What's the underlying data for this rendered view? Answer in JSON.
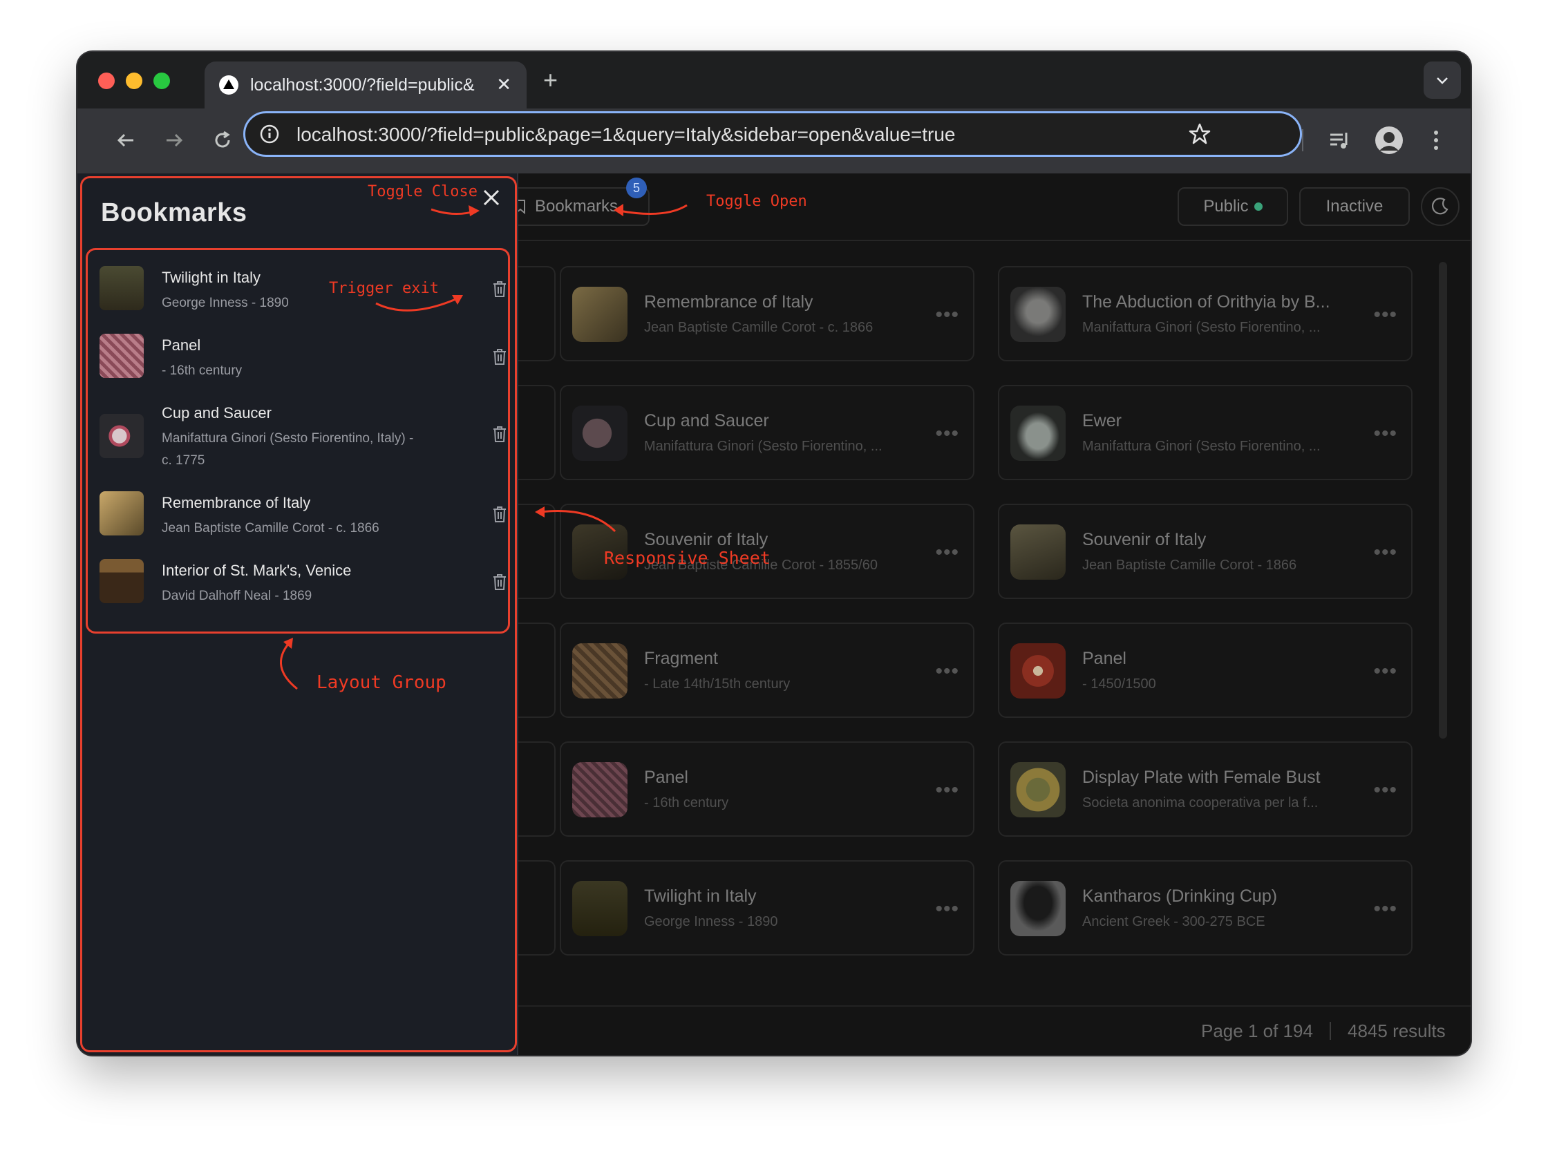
{
  "browser": {
    "tab_title": "localhost:3000/?field=public&",
    "url": "localhost:3000/?field=public&page=1&query=Italy&sidebar=open&value=true",
    "new_tab_label": "+",
    "tab_close_label": "✕"
  },
  "sidebar": {
    "title": "Bookmarks",
    "items": [
      {
        "title": "Twilight in Italy",
        "subtitle": "George Inness - 1890",
        "thumb": "#3f3a25"
      },
      {
        "title": "Panel",
        "subtitle": "- 16th century",
        "thumb": "#9c5a6a"
      },
      {
        "title": "Cup and Saucer",
        "subtitle": "Manifattura Ginori (Sesto Fiorentino, Italy) - c. 1775",
        "thumb": "#2c2c30"
      },
      {
        "title": "Remembrance of Italy",
        "subtitle": "Jean Baptiste Camille Corot - c. 1866",
        "thumb": "#6d5a36"
      },
      {
        "title": "Interior of St. Mark's, Venice",
        "subtitle": "David Dalhoff Neal - 1869",
        "thumb": "#4a3522"
      }
    ]
  },
  "topbar": {
    "bookmarks_label": "Bookmarks",
    "bookmarks_count": "5",
    "public_label": "Public",
    "inactive_label": "Inactive"
  },
  "grid": {
    "col1": [
      {
        "title": "Remembrance of Italy",
        "subtitle": "Jean Baptiste Camille Corot - c. 1866",
        "thumb": "#5e5033"
      },
      {
        "title": "Cup and Saucer",
        "subtitle": "Manifattura Ginori (Sesto Fiorentino, ...",
        "thumb": "#2a2a2e"
      },
      {
        "title": "Souvenir of Italy",
        "subtitle": "Jean Baptiste Camille Corot - 1855/60",
        "thumb": "#2d2a20"
      },
      {
        "title": "Fragment",
        "subtitle": "- Late 14th/15th century",
        "thumb": "#5a4533"
      },
      {
        "title": "Panel",
        "subtitle": "- 16th century",
        "thumb": "#5a3a42"
      },
      {
        "title": "Twilight in Italy",
        "subtitle": "George Inness - 1890",
        "thumb": "#2e2c1c"
      }
    ],
    "col2": [
      {
        "title": "The Abduction of Orithyia by B...",
        "subtitle": "Manifattura Ginori (Sesto Fiorentino, ...",
        "thumb": "#3c3c3c"
      },
      {
        "title": "Ewer",
        "subtitle": "Manifattura Ginori (Sesto Fiorentino, ...",
        "thumb": "#3a3d3b"
      },
      {
        "title": "Souvenir of Italy",
        "subtitle": "Jean Baptiste Camille Corot - 1866",
        "thumb": "#3c3828"
      },
      {
        "title": "Panel",
        "subtitle": "- 1450/1500",
        "thumb": "#6e2e22"
      },
      {
        "title": "Display Plate with Female Bust",
        "subtitle": "Societa anonima cooperativa per la f...",
        "thumb": "#4a4a30"
      },
      {
        "title": "Kantharos (Drinking Cup)",
        "subtitle": "Ancient Greek - 300-275 BCE",
        "thumb": "#3a3a3a"
      }
    ]
  },
  "footer": {
    "page_label": "Page 1 of 194",
    "results_label": "4845 results"
  },
  "annotations": {
    "toggle_close": "Toggle Close",
    "toggle_open": "Toggle Open",
    "trigger_exit": "Trigger exit",
    "responsive_sheet": "Responsive Sheet",
    "layout_group": "Layout Group"
  },
  "colors": {
    "annotation": "#ef3a24",
    "accent": "#8ab4f8",
    "status_dot": "#3aa37a",
    "badge": "#2f5fb8"
  },
  "icons": [
    "back-icon",
    "forward-icon",
    "reload-icon",
    "info-icon",
    "star-icon",
    "extensions-icon",
    "media-icon",
    "profile-avatar",
    "kebab-menu-icon",
    "close-icon",
    "trash-icon",
    "bookmark-icon",
    "moon-icon",
    "more-icon"
  ]
}
